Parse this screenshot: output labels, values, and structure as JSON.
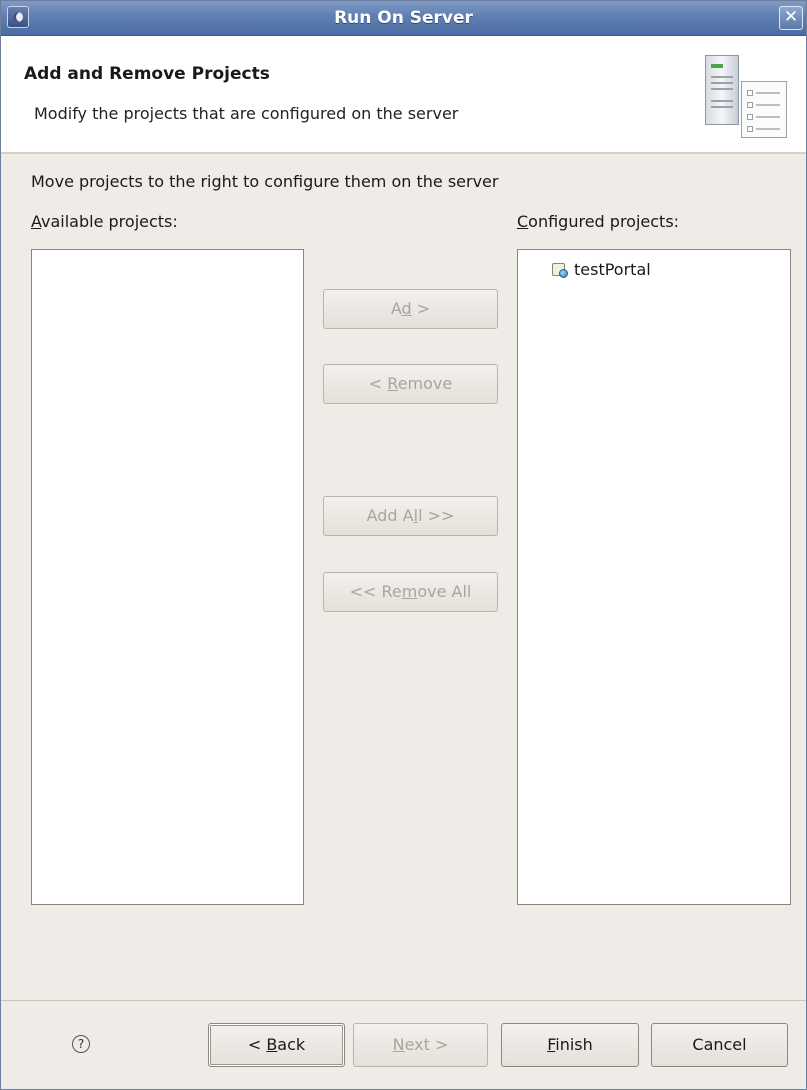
{
  "window": {
    "title": "Run On Server",
    "close_glyph": "✕"
  },
  "banner": {
    "title": "Add and Remove Projects",
    "description": "Modify the projects that are configured on the server",
    "graphic_icon": "server-wizard-icon"
  },
  "body": {
    "instruction": "Move projects to the right to configure them on the server",
    "available_label_mnemonic": "A",
    "available_label_rest": "vailable projects:",
    "configured_label_mnemonic": "C",
    "configured_label_rest": "onfigured projects:",
    "available_projects": [],
    "configured_projects": [
      {
        "name": "testPortal",
        "icon": "web-project-icon"
      }
    ]
  },
  "transfer_buttons": {
    "add": {
      "pre": "A",
      "mn": "d",
      "post": "d >",
      "enabled": false
    },
    "remove": {
      "pre": "< ",
      "mn": "R",
      "post": "emove",
      "enabled": false
    },
    "add_all": {
      "pre": "Add A",
      "mn": "l",
      "post": "l >>",
      "enabled": false
    },
    "remove_all": {
      "pre": "<< Re",
      "mn": "m",
      "post": "ove All",
      "enabled": false
    }
  },
  "footer": {
    "help_glyph": "?",
    "back": {
      "pre": "< ",
      "mn": "B",
      "post": "ack",
      "enabled": true
    },
    "next": {
      "pre": "",
      "mn": "N",
      "post": "ext >",
      "enabled": false
    },
    "finish": {
      "pre": "",
      "mn": "F",
      "post": "inish",
      "enabled": true
    },
    "cancel": {
      "label": "Cancel",
      "enabled": true
    }
  },
  "colors": {
    "titlebar": "#5f7fb2",
    "dialog_bg": "#efebe7",
    "disabled_text": "#a8a49e"
  }
}
